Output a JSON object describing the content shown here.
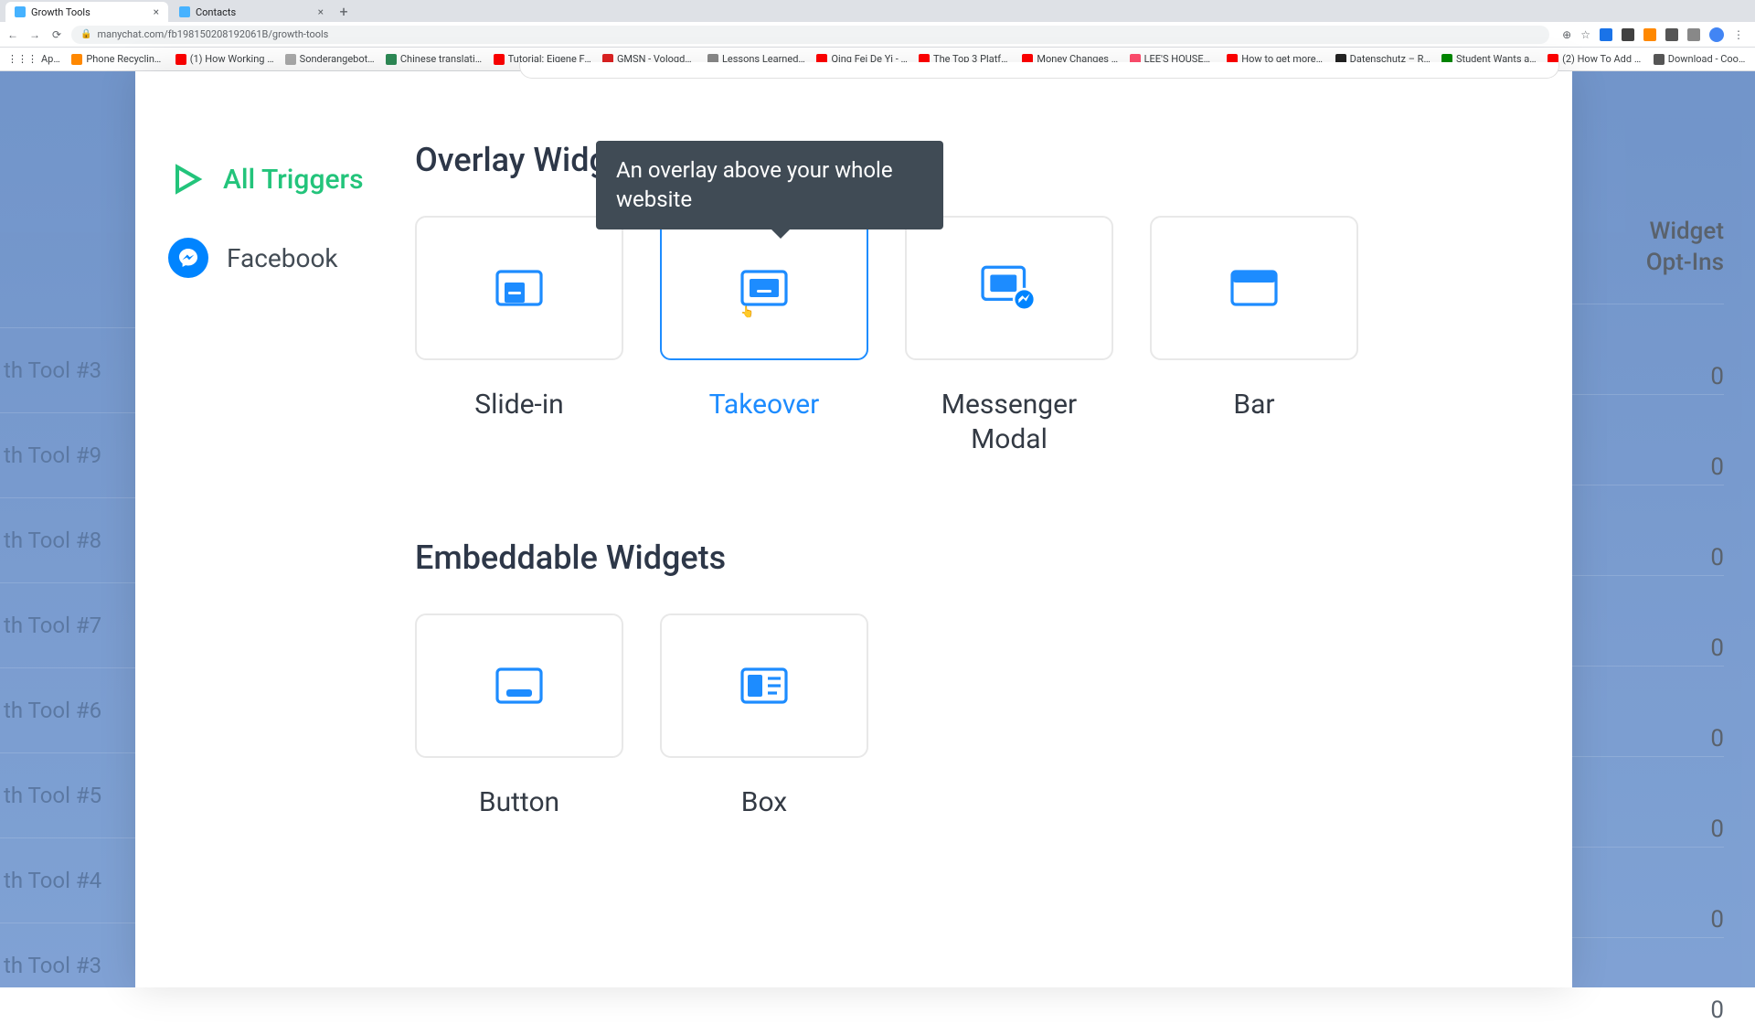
{
  "browser": {
    "tabs": [
      {
        "title": "Growth Tools",
        "active": true,
        "favicon": "#46b2ff"
      },
      {
        "title": "Contacts",
        "active": false,
        "favicon": "#46b2ff"
      }
    ],
    "url": "manychat.com/fb198150208192061B/growth-tools",
    "bookmarks": [
      {
        "label": "Apps",
        "color": "#5f6368"
      },
      {
        "label": "Phone Recycling ...",
        "color": "#ff8800"
      },
      {
        "label": "(1) How Working a...",
        "color": "#ff0000"
      },
      {
        "label": "Sonderangebot! ...",
        "color": "#aaaaaa"
      },
      {
        "label": "Chinese translatio...",
        "color": "#2e8b57"
      },
      {
        "label": "Tutorial: Eigene Fa...",
        "color": "#ff0000"
      },
      {
        "label": "GMSN - Vologda, ...",
        "color": "#dd2222"
      },
      {
        "label": "Lessons Learned f...",
        "color": "#888888"
      },
      {
        "label": "Qing Fei De Yi - Y...",
        "color": "#ff0000"
      },
      {
        "label": "The Top 3 Platfor...",
        "color": "#ff0000"
      },
      {
        "label": "Money Changes E...",
        "color": "#ff0000"
      },
      {
        "label": "LEE'S HOUSE— ...",
        "color": "#ff4d6d"
      },
      {
        "label": "How to get more v...",
        "color": "#ff0000"
      },
      {
        "label": "Datenschutz – Re...",
        "color": "#222222"
      },
      {
        "label": "Student Wants an...",
        "color": "#008800"
      },
      {
        "label": "(2) How To Add A...",
        "color": "#ff0000"
      },
      {
        "label": "Download - Cooki...",
        "color": "#555555"
      }
    ]
  },
  "sidebar": {
    "all_triggers": "All Triggers",
    "facebook": "Facebook"
  },
  "sections": {
    "overlay_title": "Overlay Widgets",
    "embed_title": "Embeddable Widgets"
  },
  "tooltip": {
    "takeover": "An overlay above your whole website"
  },
  "widgets": {
    "overlay": [
      {
        "key": "slide_in",
        "label": "Slide-in"
      },
      {
        "key": "takeover",
        "label": "Takeover",
        "active": true
      },
      {
        "key": "messenger_modal",
        "label": "Messenger Modal"
      },
      {
        "key": "bar",
        "label": "Bar"
      }
    ],
    "embed": [
      {
        "key": "button",
        "label": "Button"
      },
      {
        "key": "box",
        "label": "Box"
      }
    ]
  },
  "background": {
    "left_tools": [
      "th Tool #3",
      "th Tool #9",
      "th Tool #8",
      "th Tool #7",
      "th Tool #6",
      "th Tool #5",
      "th Tool #4",
      "th Tool #3"
    ],
    "right_header_a": "Widget",
    "right_header_b": "Opt-Ins",
    "zero": "0"
  }
}
